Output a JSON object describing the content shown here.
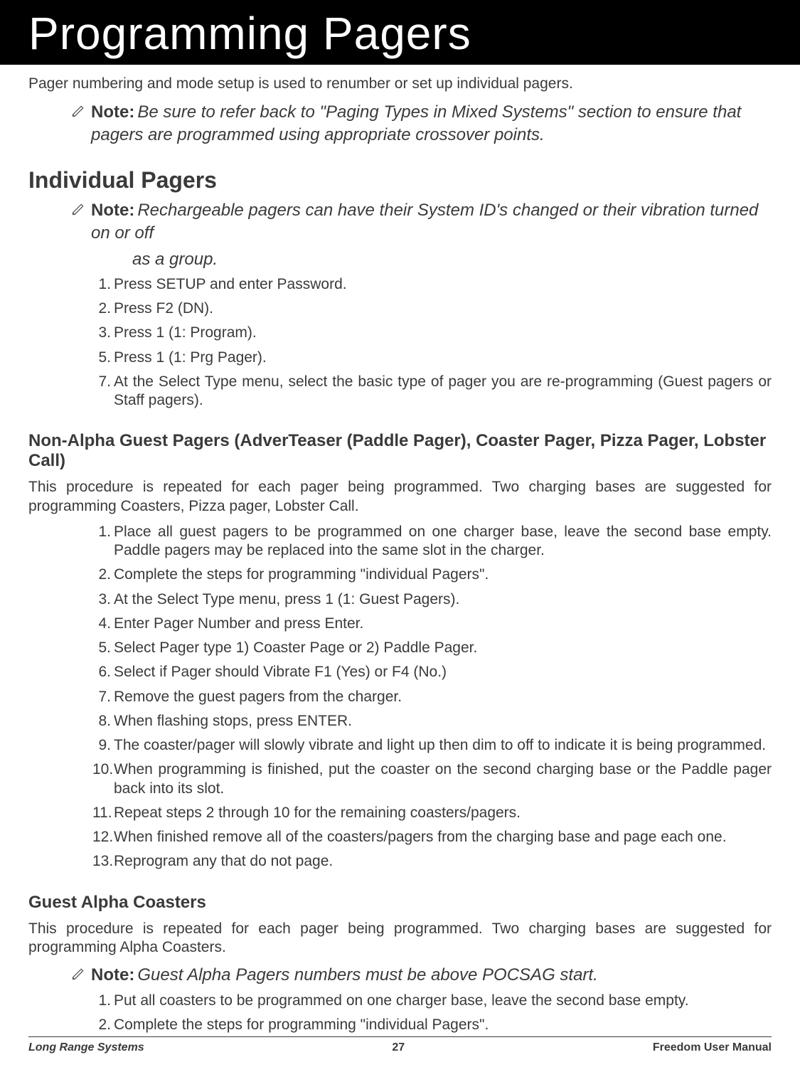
{
  "title": "Programming Pagers",
  "intro": "Pager numbering and mode setup is used to renumber or set up individual pagers.",
  "note1": {
    "label": "Note:",
    "body": "Be sure to refer back to \"Paging Types in Mixed Systems\" section to ensure that pagers are programmed using appropriate crossover points."
  },
  "h2_individual": "Individual Pagers",
  "note2": {
    "label": "Note:",
    "body_line1": "Rechargeable pagers can have their System ID's changed or their vibration turned on or off",
    "body_line2": "as a group."
  },
  "list_individual": [
    {
      "n": "1.",
      "t": "Press SETUP and enter Password."
    },
    {
      "n": "2.",
      "t": "Press F2 (DN)."
    },
    {
      "n": "3.",
      "t": "Press 1 (1: Program)."
    },
    {
      "n": "5.",
      "t": "Press 1 (1: Prg Pager)."
    },
    {
      "n": "7.",
      "t": "At the Select Type menu, select the basic type of pager you are re-programming (Guest pagers or Staff pagers)."
    }
  ],
  "h3_nonalpha": "Non-Alpha Guest Pagers (AdverTeaser (Paddle Pager), Coaster Pager, Pizza Pager, Lobster Call)",
  "p_nonalpha": "This procedure is repeated for each pager being programmed. Two charging bases are suggested for programming Coasters, Pizza pager, Lobster Call.",
  "list_nonalpha": [
    {
      "n": "1.",
      "t": "Place all guest pagers to be programmed on one charger base, leave the second base empty.  Paddle pagers may be replaced into the same slot in the charger."
    },
    {
      "n": "2.",
      "t": "Complete the steps for programming \"individual Pagers\"."
    },
    {
      "n": "3.",
      "t": "At the Select Type menu, press 1 (1: Guest Pagers)."
    },
    {
      "n": "4.",
      "t": "Enter Pager Number and press Enter."
    },
    {
      "n": "5.",
      "t": "Select Pager type 1) Coaster Page or 2) Paddle Pager."
    },
    {
      "n": "6.",
      "t": "Select if Pager should Vibrate F1 (Yes) or F4 (No.)"
    },
    {
      "n": "7.",
      "t": "Remove the guest pagers from the charger."
    },
    {
      "n": "8.",
      "t": "When flashing stops, press ENTER."
    },
    {
      "n": "9.",
      "t": "The coaster/pager will slowly vibrate and light up then dim to off to indicate it is being programmed."
    },
    {
      "n": "10.",
      "t": "When programming is finished, put the coaster on the second charging base or the Paddle pager back into its slot."
    },
    {
      "n": "11.",
      "t": "Repeat steps 2 through 10 for the remaining coasters/pagers."
    },
    {
      "n": "12.",
      "t": "When finished remove all of the coasters/pagers from the charging base and page each one."
    },
    {
      "n": "13.",
      "t": "Reprogram any that do not page."
    }
  ],
  "h3_alpha": "Guest Alpha Coasters",
  "p_alpha": "This procedure is repeated for each pager being programmed. Two charging bases are suggested for programming Alpha Coasters.",
  "note3": {
    "label": "Note:",
    "body": "Guest Alpha Pagers numbers must be above POCSAG start."
  },
  "list_alpha": [
    {
      "n": "1.",
      "t": "Put all coasters to be programmed on one charger base, leave the second base empty."
    },
    {
      "n": "2.",
      "t": "Complete the steps for programming \"individual Pagers\"."
    }
  ],
  "footer": {
    "left": "Long Range Systems",
    "center": "27",
    "right": "Freedom User Manual"
  }
}
